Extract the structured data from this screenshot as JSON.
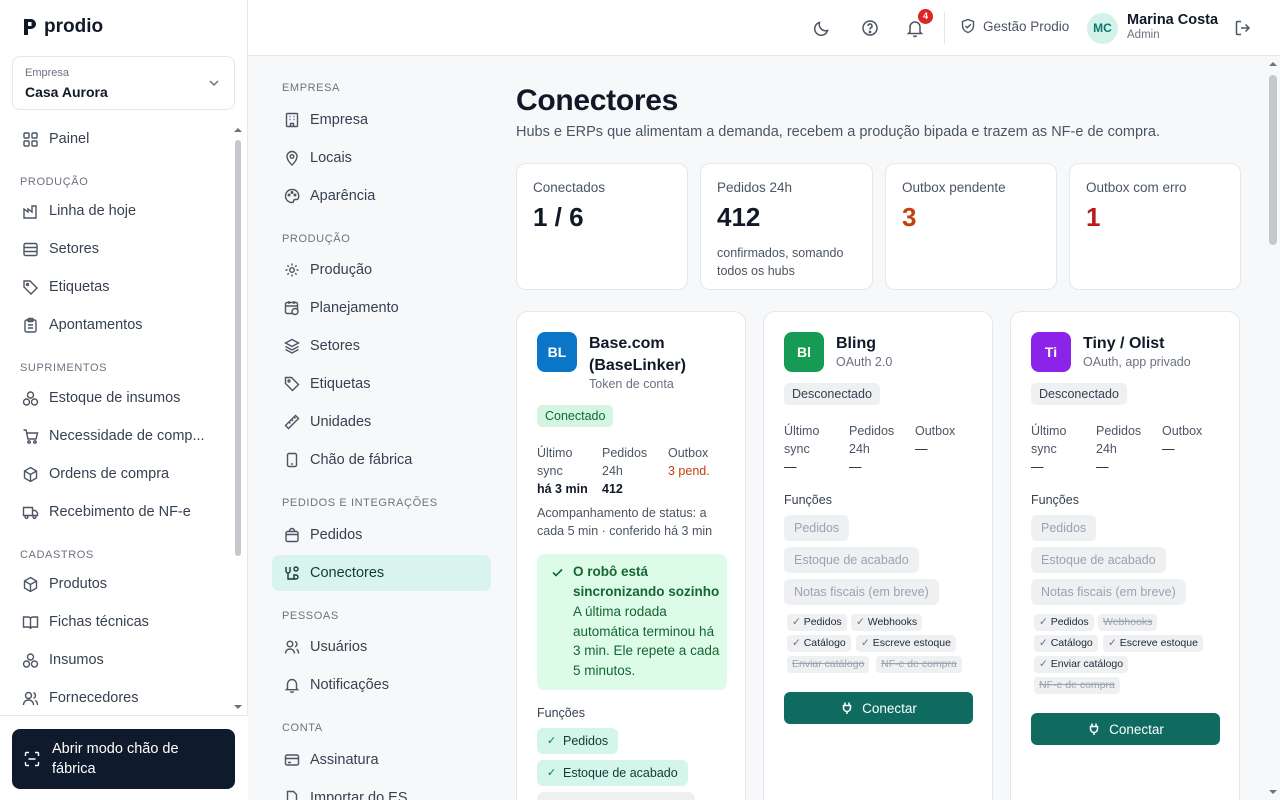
{
  "brand": {
    "name": "prodio"
  },
  "company": {
    "label": "Empresa",
    "value": "Casa Aurora"
  },
  "sidebar": {
    "top": [
      {
        "label": "Painel",
        "icon": "dashboard-icon"
      }
    ],
    "sections": [
      {
        "title": "PRODUÇÃO",
        "items": [
          "Linha de hoje",
          "Setores",
          "Etiquetas",
          "Apontamentos"
        ]
      },
      {
        "title": "SUPRIMENTOS",
        "items": [
          "Estoque de insumos",
          "Necessidade de comp...",
          "Ordens de compra",
          "Recebimento de NF-e"
        ]
      },
      {
        "title": "CADASTROS",
        "items": [
          "Produtos",
          "Fichas técnicas",
          "Insumos",
          "Fornecedores"
        ]
      }
    ],
    "footer_button": "Abrir modo chão de fábrica"
  },
  "topbar": {
    "notifications_count": "4",
    "workspace": "Gestão Prodio",
    "user": {
      "initials": "MC",
      "name": "Marina Costa",
      "role": "Admin"
    }
  },
  "settings_nav": {
    "sections": [
      {
        "title": "EMPRESA",
        "items": [
          "Empresa",
          "Locais",
          "Aparência"
        ]
      },
      {
        "title": "PRODUÇÃO",
        "items": [
          "Produção",
          "Planejamento",
          "Setores",
          "Etiquetas",
          "Unidades",
          "Chão de fábrica"
        ]
      },
      {
        "title": "PEDIDOS E INTEGRAÇÕES",
        "items": [
          "Pedidos",
          "Conectores"
        ]
      },
      {
        "title": "PESSOAS",
        "items": [
          "Usuários",
          "Notificações"
        ]
      },
      {
        "title": "CONTA",
        "items": [
          "Assinatura",
          "Importar do ES"
        ]
      }
    ],
    "active": "Conectores"
  },
  "page": {
    "title": "Conectores",
    "subtitle": "Hubs e ERPs que alimentam a demanda, recebem a produção bipada e trazem as NF-e de compra."
  },
  "stats": [
    {
      "label": "Conectados",
      "value": "1 / 6",
      "note": ""
    },
    {
      "label": "Pedidos 24h",
      "value": "412",
      "note": "confirmados, somando todos os hubs"
    },
    {
      "label": "Outbox pendente",
      "value": "3",
      "note": ""
    },
    {
      "label": "Outbox com erro",
      "value": "1",
      "note": ""
    }
  ],
  "colors": {
    "accent": "#0f6b5f",
    "warning": "#c2410c",
    "danger": "#b91c1c"
  },
  "connectors": [
    {
      "initials": "BL",
      "name": "Base.com (BaseLinker)",
      "auth": "Token de conta",
      "color": "#0b76c8",
      "status": "Conectado",
      "metrics": {
        "last_sync_label": "Último sync",
        "last_sync": "há 3 min",
        "orders_label": "Pedidos 24h",
        "orders": "412",
        "outbox_label": "Outbox",
        "outbox": "3 pend."
      },
      "status_note": "Acompanhamento de status: a cada 5 min · conferido há 3 min",
      "robot_title": "O robô está sincronizando sozinho",
      "robot_body": "A última rodada automática terminou há 3 min. Ele repete a cada 5 minutos.",
      "functions_label": "Funções",
      "functions": [
        "Pedidos",
        "Estoque de acabado"
      ]
    },
    {
      "initials": "Bl",
      "name": "Bling",
      "auth": "OAuth 2.0",
      "color": "#169b55",
      "status": "Desconectado",
      "metrics": {
        "last_sync_label": "Último sync",
        "last_sync": "—",
        "orders_label": "Pedidos 24h",
        "orders": "—",
        "outbox_label": "Outbox",
        "outbox": "—"
      },
      "functions_label": "Funções",
      "functions": [
        "Pedidos",
        "Estoque de acabado",
        "Notas fiscais (em breve)"
      ],
      "capabilities": [
        {
          "label": "Pedidos",
          "on": true
        },
        {
          "label": "Webhooks",
          "on": true
        },
        {
          "label": "Catálogo",
          "on": true
        },
        {
          "label": "Escreve estoque",
          "on": true
        },
        {
          "label": "Enviar catálogo",
          "on": false
        },
        {
          "label": "NF-e de compra",
          "on": false
        }
      ],
      "button": "Conectar"
    },
    {
      "initials": "Ti",
      "name": "Tiny / Olist",
      "auth": "OAuth, app privado",
      "color": "#8b24e8",
      "status": "Desconectado",
      "metrics": {
        "last_sync_label": "Último sync",
        "last_sync": "—",
        "orders_label": "Pedidos 24h",
        "orders": "—",
        "outbox_label": "Outbox",
        "outbox": "—"
      },
      "functions_label": "Funções",
      "functions": [
        "Pedidos",
        "Estoque de acabado",
        "Notas fiscais (em breve)"
      ],
      "capabilities": [
        {
          "label": "Pedidos",
          "on": true
        },
        {
          "label": "Webhooks",
          "on": false
        },
        {
          "label": "Catálogo",
          "on": true
        },
        {
          "label": "Escreve estoque",
          "on": true
        },
        {
          "label": "Enviar catálogo",
          "on": true
        },
        {
          "label": "NF-e de compra",
          "on": false
        }
      ],
      "button": "Conectar"
    }
  ]
}
